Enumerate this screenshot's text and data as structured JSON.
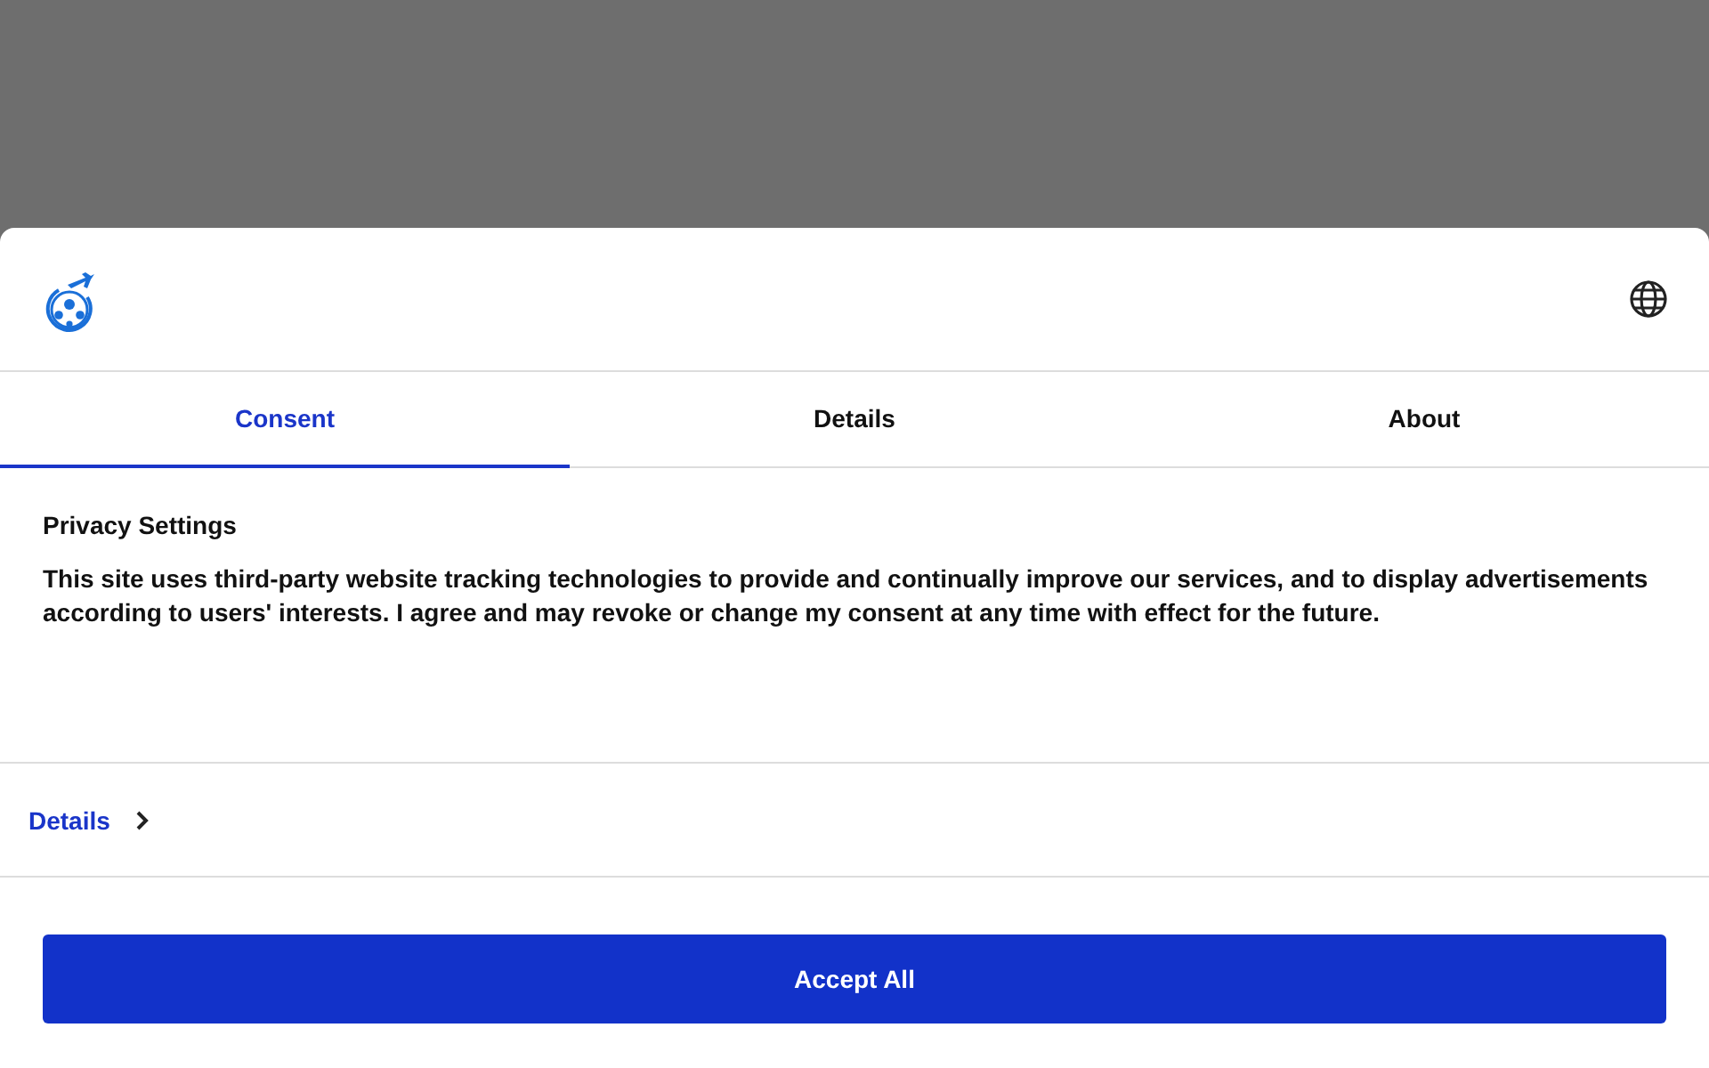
{
  "dialog": {
    "tabs": [
      {
        "label": "Consent",
        "selected": true
      },
      {
        "label": "Details",
        "selected": false
      },
      {
        "label": "About",
        "selected": false
      }
    ],
    "title": "Privacy Settings",
    "body": "This site uses third-party website tracking technologies to provide and continually improve our services, and to display advertisements according to users' interests. I agree and may revoke or change my consent at any time with effect for the future.",
    "details_link": "Details",
    "accept_button": "Accept All"
  }
}
